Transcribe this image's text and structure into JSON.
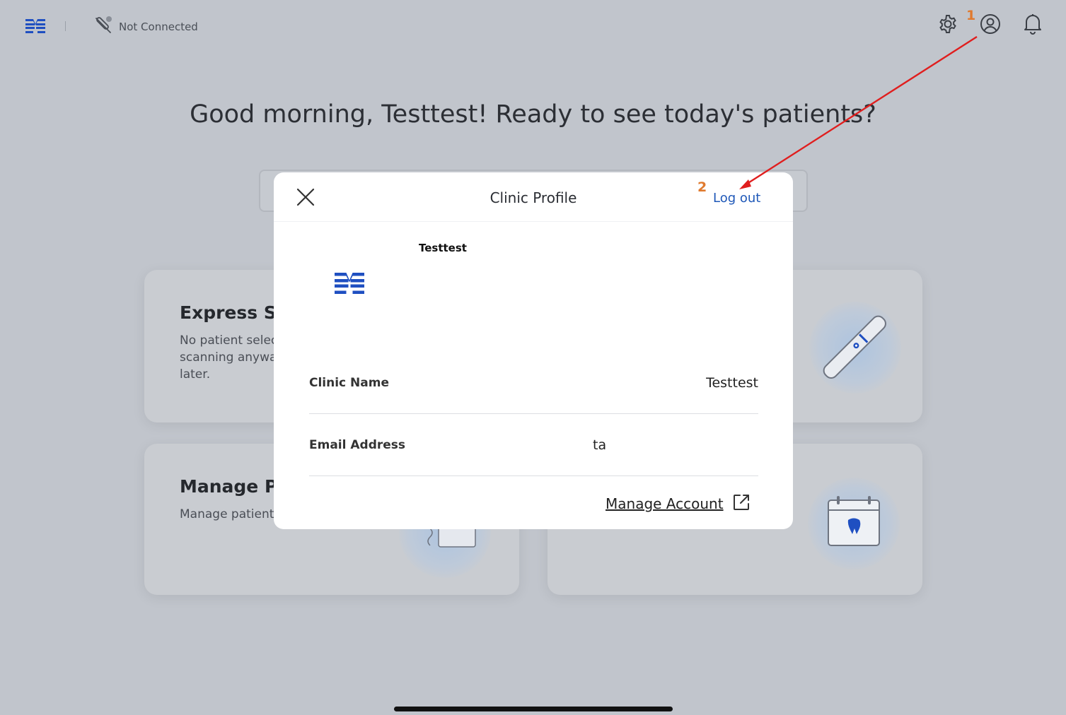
{
  "header": {
    "connection_status": "Not Connected",
    "icons": [
      "app-logo",
      "scanner-disconnected-icon",
      "gear-icon",
      "user-circle-icon",
      "bell-icon"
    ]
  },
  "greeting": "Good morning, Testtest! Ready to see today's patients?",
  "cards": [
    {
      "title": "Express Sca",
      "description": "No patient selec\nscanning anywa\nlater."
    },
    {
      "title": "Manage Pa",
      "description": "Manage patient"
    }
  ],
  "modal": {
    "title": "Clinic Profile",
    "logout_label": "Log out",
    "clinic_display_name": "Testtest",
    "fields": [
      {
        "label": "Clinic Name",
        "value": "Testtest"
      },
      {
        "label": "Email Address",
        "value": "ta"
      }
    ],
    "manage_account_label": "Manage Account"
  },
  "annotations": {
    "step1": "1",
    "step2": "2",
    "arrow_color": "#e01e1e",
    "number_color": "#e07a2e"
  },
  "colors": {
    "brand_blue": "#1f4fc1",
    "link_blue": "#1f58b8",
    "backdrop": "#c1c5cc"
  }
}
